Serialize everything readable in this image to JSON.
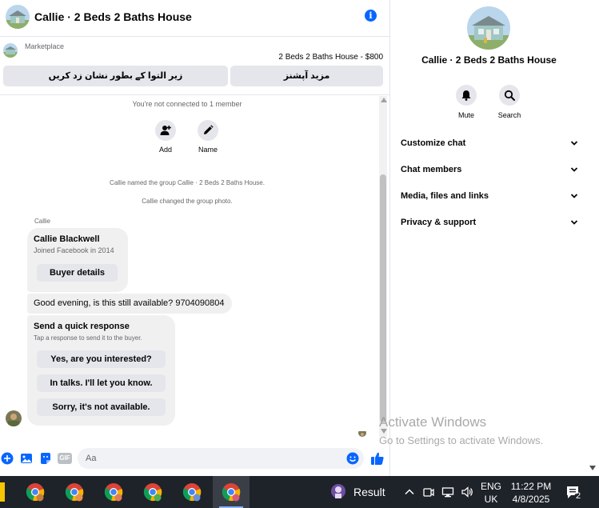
{
  "chat": {
    "title": "Callie · 2 Beds 2 Baths House",
    "marketplace_label": "Marketplace",
    "listing": "2 Beds 2 Baths House - $800",
    "btn_mark_pending": "زیر التوا کے بطور نشان زد کریں",
    "btn_more_options": "مزید آپشنز",
    "not_connected": "You're not connected to 1 member",
    "action_add": "Add",
    "action_name": "Name",
    "sys_renamed": "Callie named the group Callie · 2 Beds 2 Baths House.",
    "sys_photo": "Callie changed the group photo.",
    "sender_name": "Callie",
    "profile_card": {
      "name": "Callie Blackwell",
      "subtitle": "Joined Facebook in 2014",
      "button": "Buyer details"
    },
    "message": "Good evening, is this still available? 9704090804",
    "quick_response": {
      "title": "Send a quick response",
      "subtitle": "Tap a response to send it to the buyer.",
      "options": [
        "Yes, are you interested?",
        "In talks. I'll let you know.",
        "Sorry, it's not available."
      ]
    },
    "composer_placeholder": "Aa",
    "gif_label": "GIF"
  },
  "details": {
    "title": "Callie · 2 Beds 2 Baths House",
    "mute": "Mute",
    "search": "Search",
    "rows": [
      "Customize chat",
      "Chat members",
      "Media, files and links",
      "Privacy & support"
    ]
  },
  "watermark": {
    "line1": "Activate Windows",
    "line2": "Go to Settings to activate Windows."
  },
  "taskbar": {
    "result_label": "Result",
    "lang_line1": "ENG",
    "lang_line2": "UK",
    "time": "11:22 PM",
    "date": "4/8/2025",
    "notification_count": "2"
  },
  "colors": {
    "accent": "#0866ff",
    "bubble": "#f0f0f0",
    "button": "#e4e6eb",
    "taskbar": "#1e2229"
  }
}
